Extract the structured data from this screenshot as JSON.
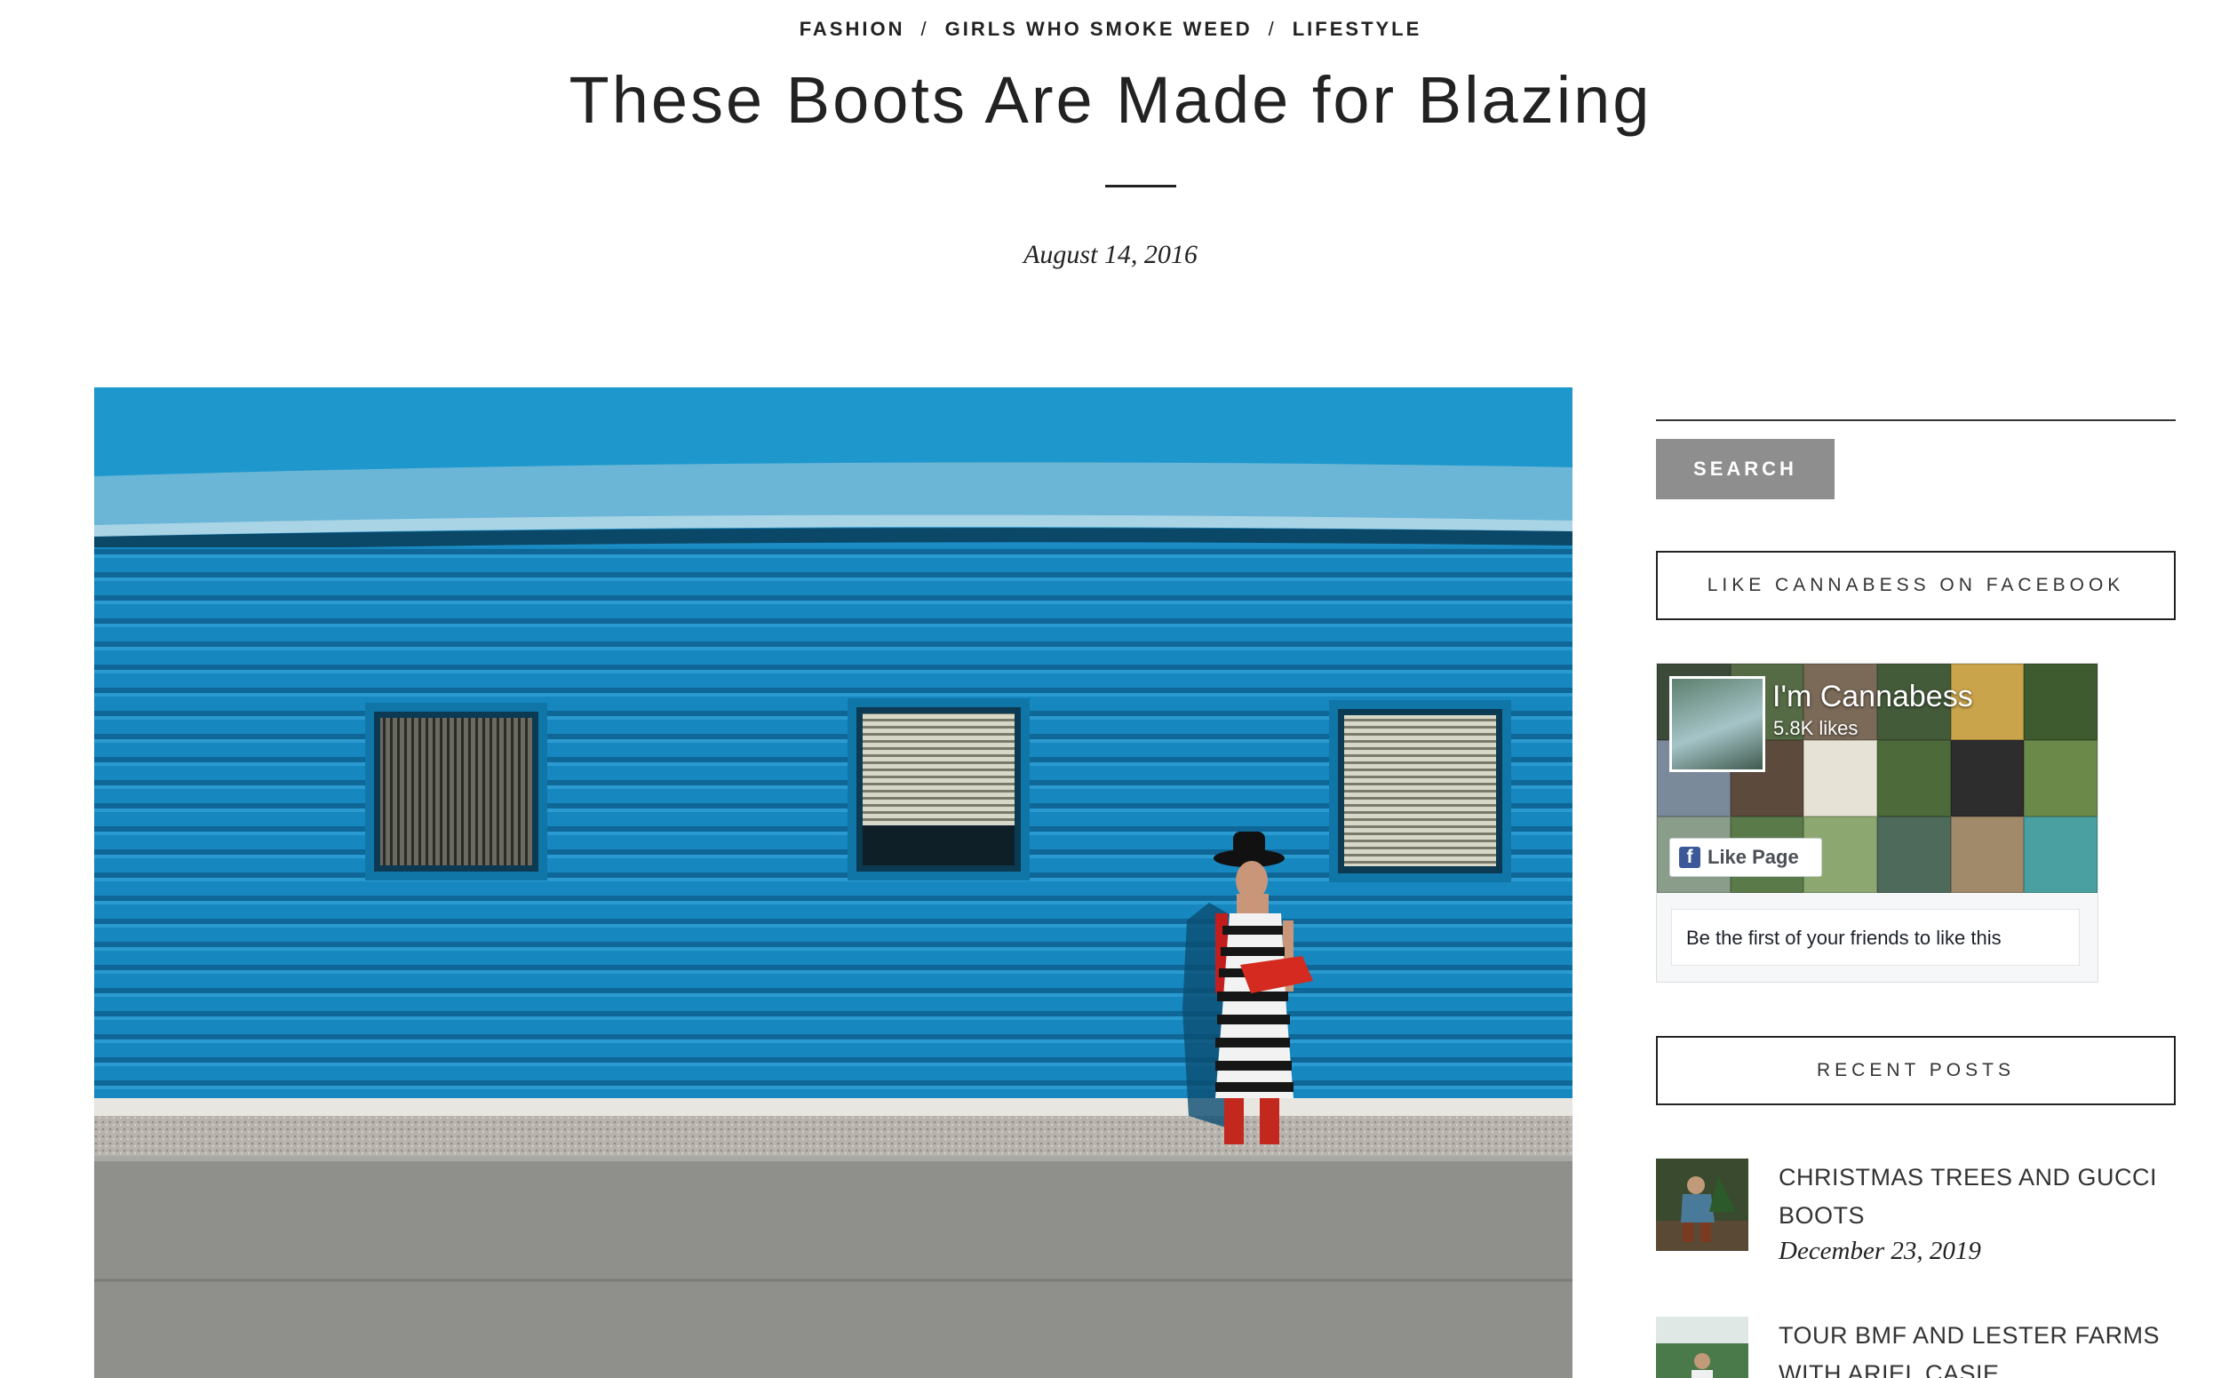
{
  "breadcrumbs": [
    "FASHION",
    "GIRLS WHO SMOKE WEED",
    "LIFESTYLE"
  ],
  "breadcrumb_separator": "/",
  "post": {
    "title": "These Boots Are Made for Blazing",
    "date": "August 14, 2016"
  },
  "sidebar": {
    "search_button": "SEARCH",
    "facebook_widget_title": "LIKE CANNABESS ON FACEBOOK",
    "facebook": {
      "page_name": "I'm Cannabess",
      "likes": "5.8K likes",
      "like_button": "Like Page",
      "friends_text": "Be the first of your friends to like this",
      "brand_color": "#3b5998"
    },
    "recent_posts_title": "RECENT POSTS",
    "recent_posts": [
      {
        "title": "CHRISTMAS TREES AND GUCCI BOOTS",
        "date": "December 23, 2019"
      },
      {
        "title": "TOUR BMF AND LESTER FARMS WITH ARIEL CASIE",
        "date": ""
      }
    ]
  },
  "colors": {
    "wall_blue": "#1b8cc4",
    "button_gray": "#8e8e8e",
    "text": "#222222"
  }
}
